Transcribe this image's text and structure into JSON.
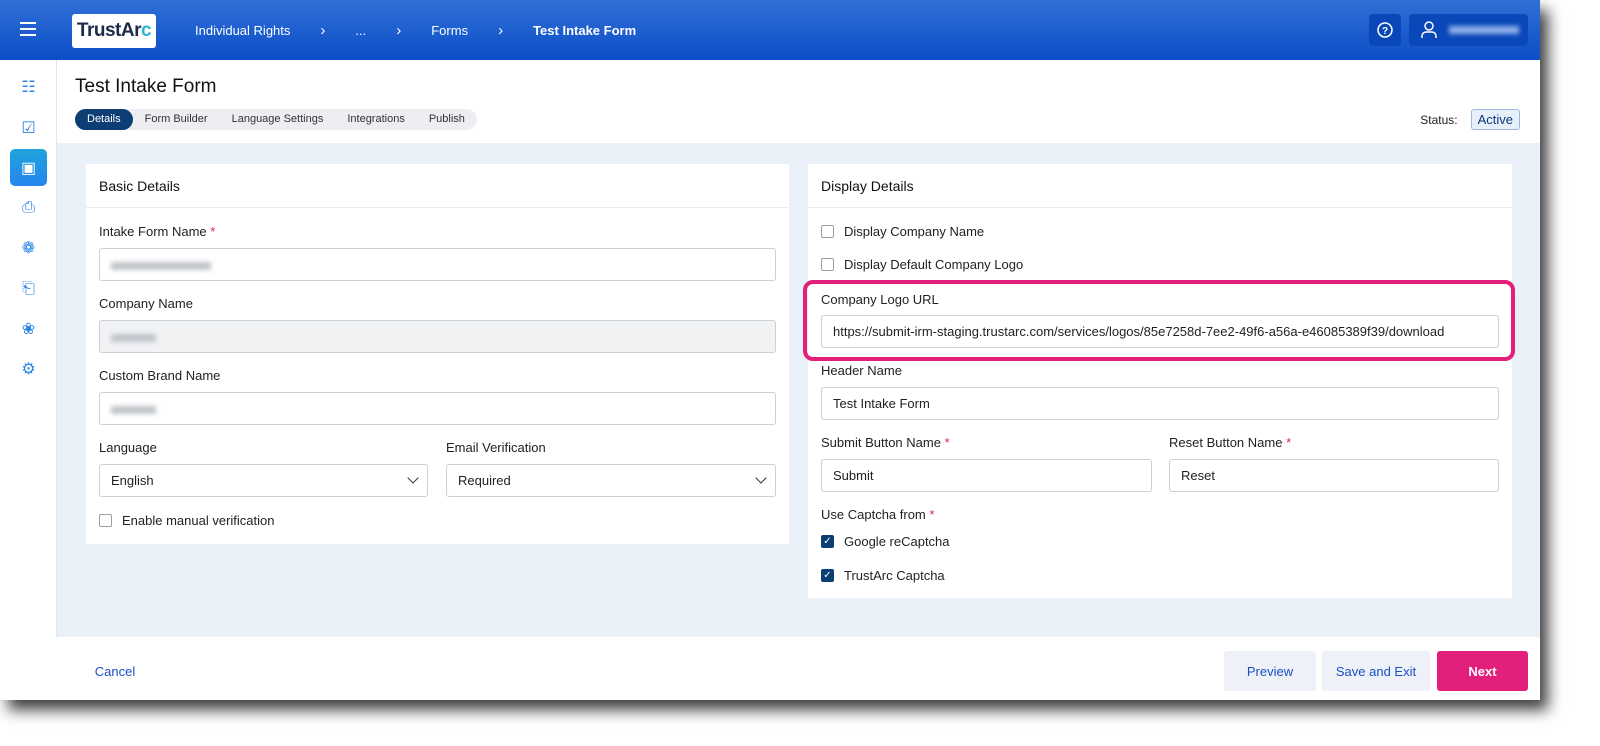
{
  "header": {
    "logo": "TrustArc",
    "breadcrumbs": [
      "Individual Rights",
      "...",
      "Forms",
      "Test Intake Form"
    ],
    "separator": ">"
  },
  "page": {
    "title": "Test Intake Form",
    "tabs": [
      "Details",
      "Form Builder",
      "Language Settings",
      "Integrations",
      "Publish"
    ],
    "active_tab": "Details",
    "status_label": "Status:",
    "status_value": "Active"
  },
  "basic": {
    "title": "Basic Details",
    "form_name_label": "Intake Form Name",
    "company_name_label": "Company Name",
    "brand_label": "Custom Brand Name",
    "language_label": "Language",
    "language_value": "English",
    "email_label": "Email Verification",
    "email_value": "Required",
    "manual_label": "Enable manual verification"
  },
  "display": {
    "title": "Display Details",
    "show_company": "Display Company Name",
    "show_logo": "Display Default Company Logo",
    "logo_url_label": "Company Logo URL",
    "logo_url": "https://submit-irm-staging.trustarc.com/services/logos/85e7258d-7ee2-49f6-a56a-e46085389f39/download",
    "header_label": "Header Name",
    "header_value": "Test Intake Form",
    "submit_label": "Submit Button Name",
    "submit_value": "Submit",
    "reset_label": "Reset Button Name",
    "reset_value": "Reset",
    "captcha_label": "Use Captcha from",
    "google": "Google reCaptcha",
    "trustarc": "TrustArc Captcha"
  },
  "footer": {
    "cancel": "Cancel",
    "preview": "Preview",
    "save": "Save and Exit",
    "next": "Next"
  },
  "required_mark": "*",
  "colors": {
    "header": "#0b4ec8",
    "accent": "#e21f7b",
    "nav": "#0c3e74"
  }
}
